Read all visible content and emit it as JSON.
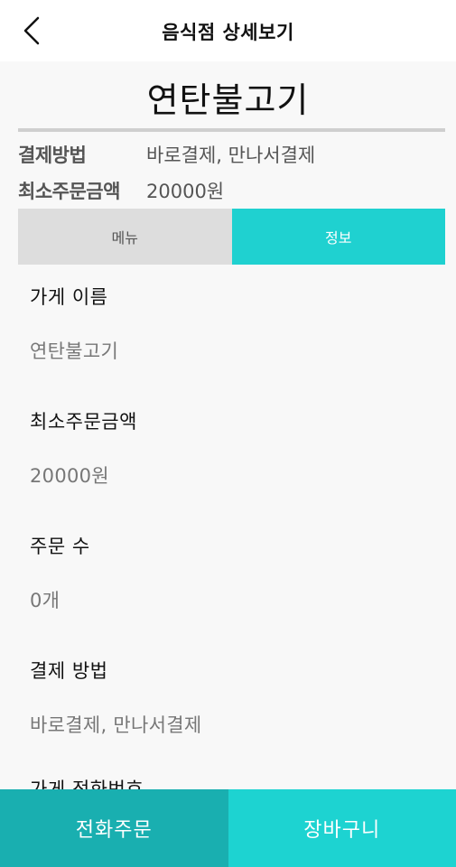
{
  "header": {
    "title": "음식점 상세보기",
    "back_icon": "chevron-left-icon"
  },
  "store": {
    "name": "연탄불고기",
    "summary": [
      {
        "label": "결제방법",
        "value": "바로결제, 만나서결제"
      },
      {
        "label": "최소주문금액",
        "value": "20000원"
      }
    ]
  },
  "tabs": [
    {
      "label": "메뉴",
      "active": false
    },
    {
      "label": "정보",
      "active": true
    }
  ],
  "info": [
    {
      "label": "가게 이름",
      "value": "연탄불고기"
    },
    {
      "label": "최소주문금액",
      "value": "20000원"
    },
    {
      "label": "주문 수",
      "value": "0개"
    },
    {
      "label": "결제 방법",
      "value": "바로결제, 만나서결제"
    },
    {
      "label": "가게 전화번호"
    }
  ],
  "bottom": {
    "call_label": "전화주문",
    "cart_label": "장바구니"
  },
  "colors": {
    "accent": "#1fd1d0",
    "accent_dark": "#19afb0",
    "tab_inactive": "#dddddd"
  }
}
